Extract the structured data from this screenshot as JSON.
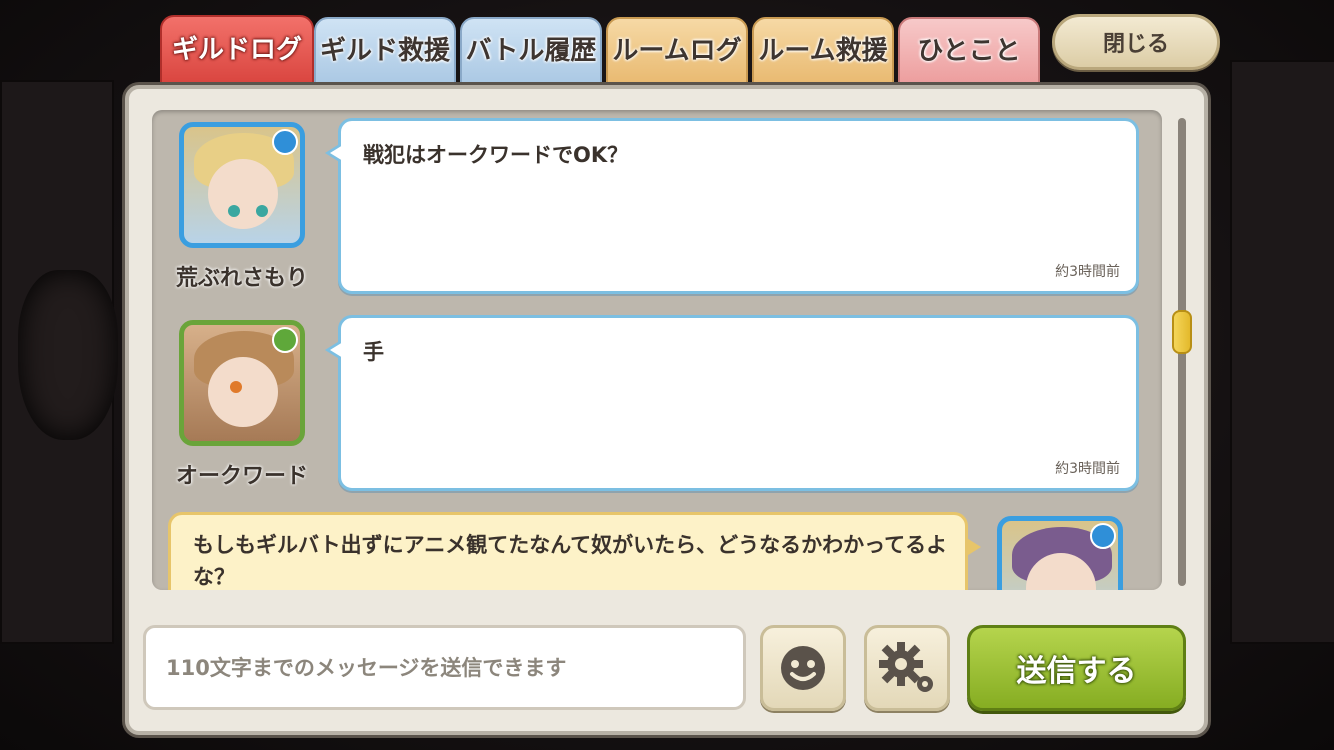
{
  "tabs": [
    {
      "label": "ギルドログ",
      "active": true
    },
    {
      "label": "ギルド救援",
      "active": false
    },
    {
      "label": "バトル履歴",
      "active": false
    },
    {
      "label": "ルームログ",
      "active": false
    },
    {
      "label": "ルーム救援",
      "active": false
    },
    {
      "label": "ひとこと",
      "active": false
    }
  ],
  "close_label": "閉じる",
  "messages": [
    {
      "user": "荒ぶれさもり",
      "text": "戦犯はオークワードでOK？",
      "time": "約3時間前",
      "avatar": "blonde-girl-avatar",
      "element": "water"
    },
    {
      "user": "オークワード",
      "text": "手",
      "time": "約3時間前",
      "avatar": "brown-hair-girl-avatar",
      "element": "wind"
    },
    {
      "user": "",
      "text": "もしもギルバト出ずにアニメ観てたなんて奴がいたら、どうなるかわかってるよな？",
      "time": "",
      "avatar": "self-avatar",
      "element": "water"
    }
  ],
  "input": {
    "placeholder": "110文字までのメッセージを送信できます",
    "value": ""
  },
  "emoji_button": "smiley-icon",
  "settings_button": "gear-icon",
  "send_label": "送信する",
  "colors": {
    "accent_red": "#d8433d",
    "send_green": "#86ad22",
    "bubble_border": "#7cbfe2"
  }
}
